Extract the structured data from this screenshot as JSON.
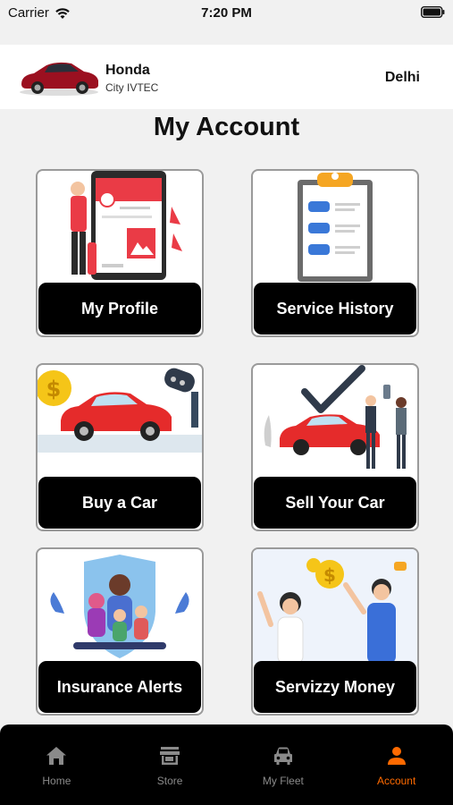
{
  "status": {
    "carrier": "Carrier",
    "time": "7:20 PM"
  },
  "car": {
    "make": "Honda",
    "model": "City IVTEC",
    "city": "Delhi"
  },
  "page_title": "My Account",
  "tiles": [
    {
      "label": "My Profile"
    },
    {
      "label": "Service History"
    },
    {
      "label": "Buy a Car"
    },
    {
      "label": "Sell Your Car"
    },
    {
      "label": "Insurance Alerts"
    },
    {
      "label": "Servizzy Money"
    }
  ],
  "tabs": [
    {
      "label": "Home",
      "icon": "home-icon"
    },
    {
      "label": "Store",
      "icon": "store-icon"
    },
    {
      "label": "My Fleet",
      "icon": "car-icon"
    },
    {
      "label": "Account",
      "icon": "person-icon",
      "active": true
    }
  ],
  "colors": {
    "accent": "#ff6a00",
    "tab_bar": "#000000",
    "tile_label_bg": "#000000",
    "background": "#f1f1f1"
  }
}
